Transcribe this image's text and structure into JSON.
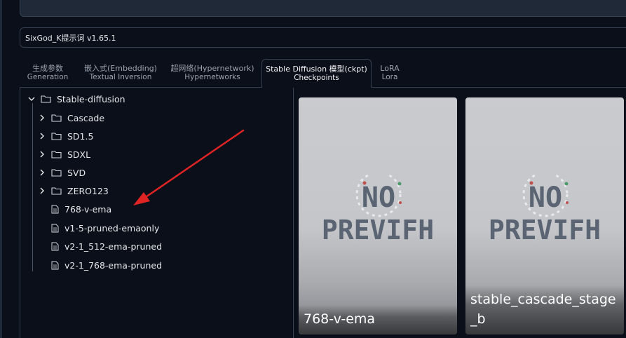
{
  "extension": {
    "title": "SixGod_K提示词 v1.65.1"
  },
  "tabs": [
    {
      "line1": "生成参数",
      "line2": "Generation"
    },
    {
      "line1": "嵌入式(Embedding)",
      "line2": "Textual Inversion"
    },
    {
      "line1": "超网络(Hypernetwork)",
      "line2": "Hypernetworks"
    },
    {
      "line1": "Stable Diffusion 模型(ckpt)",
      "line2": "Checkpoints"
    },
    {
      "line1": "LoRA",
      "line2": "Lora"
    }
  ],
  "active_tab": "Stable Diffusion 模型(ckpt)",
  "tree": {
    "root": {
      "label": "Stable-diffusion",
      "expanded": true,
      "icon": "folder-icon"
    },
    "folders": [
      {
        "label": "Cascade",
        "icon": "folder-icon"
      },
      {
        "label": "SD1.5",
        "icon": "folder-icon"
      },
      {
        "label": "SDXL",
        "icon": "folder-icon"
      },
      {
        "label": "SVD",
        "icon": "folder-icon"
      },
      {
        "label": "ZERO123",
        "icon": "folder-icon"
      }
    ],
    "files": [
      {
        "label": "768-v-ema",
        "icon": "file-icon"
      },
      {
        "label": "v1-5-pruned-emaonly",
        "icon": "file-icon"
      },
      {
        "label": "v2-1_512-ema-pruned",
        "icon": "file-icon"
      },
      {
        "label": "v2-1_768-ema-pruned",
        "icon": "file-icon"
      }
    ]
  },
  "cards": [
    {
      "name": "768-v-ema",
      "preview_line1": "NO",
      "preview_line2": "PREVIFH"
    },
    {
      "name": "stable_cascade_stage_b",
      "preview_line1": "NO",
      "preview_line2": "PREVIFH"
    }
  ],
  "colors": {
    "background": "#0b0f19",
    "border": "#374151",
    "arrow": "#e02424",
    "preview_text": "#5b6472"
  }
}
